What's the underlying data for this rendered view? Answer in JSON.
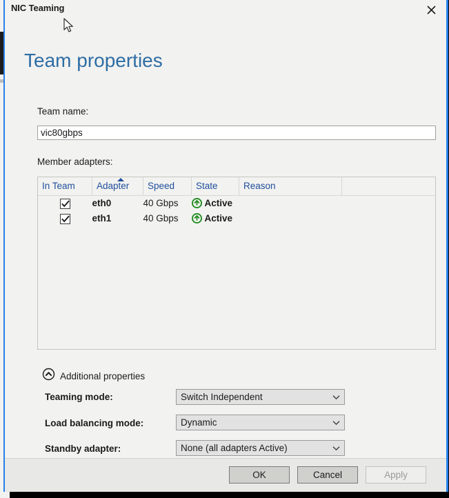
{
  "window": {
    "title": "NIC Teaming",
    "close_icon": "close-icon"
  },
  "page": {
    "heading": "Team properties"
  },
  "team_name": {
    "label": "Team name:",
    "value": "vic80gbps",
    "placeholder": ""
  },
  "member_adapters": {
    "label": "Member adapters:",
    "columns": [
      "In Team",
      "Adapter",
      "Speed",
      "State",
      "Reason"
    ],
    "sorted_column": "Adapter",
    "sort_direction": "ascending",
    "rows": [
      {
        "in_team": true,
        "adapter": "eth0",
        "speed": "40 Gbps",
        "state": "Active",
        "state_icon": "arrow-up-circle-icon",
        "reason": ""
      },
      {
        "in_team": true,
        "adapter": "eth1",
        "speed": "40 Gbps",
        "state": "Active",
        "state_icon": "arrow-up-circle-icon",
        "reason": ""
      }
    ]
  },
  "additional_properties": {
    "label": "Additional properties",
    "expanded": true,
    "toggle_icon": "chevron-up-circle-icon",
    "fields": [
      {
        "label": "Teaming mode:",
        "value": "Switch Independent"
      },
      {
        "label": "Load balancing mode:",
        "value": "Dynamic"
      },
      {
        "label": "Standby adapter:",
        "value": "None (all adapters Active)"
      }
    ]
  },
  "footer": {
    "ok_label": "OK",
    "cancel_label": "Cancel",
    "apply_label": "Apply",
    "apply_disabled": true
  },
  "colors": {
    "accent_blue": "#2680eb",
    "heading_blue": "#2e6da4",
    "header_link_blue": "#1f4e9c",
    "status_green": "#1e8c1e",
    "dialog_bg": "#f2f2f0",
    "footer_bg": "#e8e8e6"
  }
}
